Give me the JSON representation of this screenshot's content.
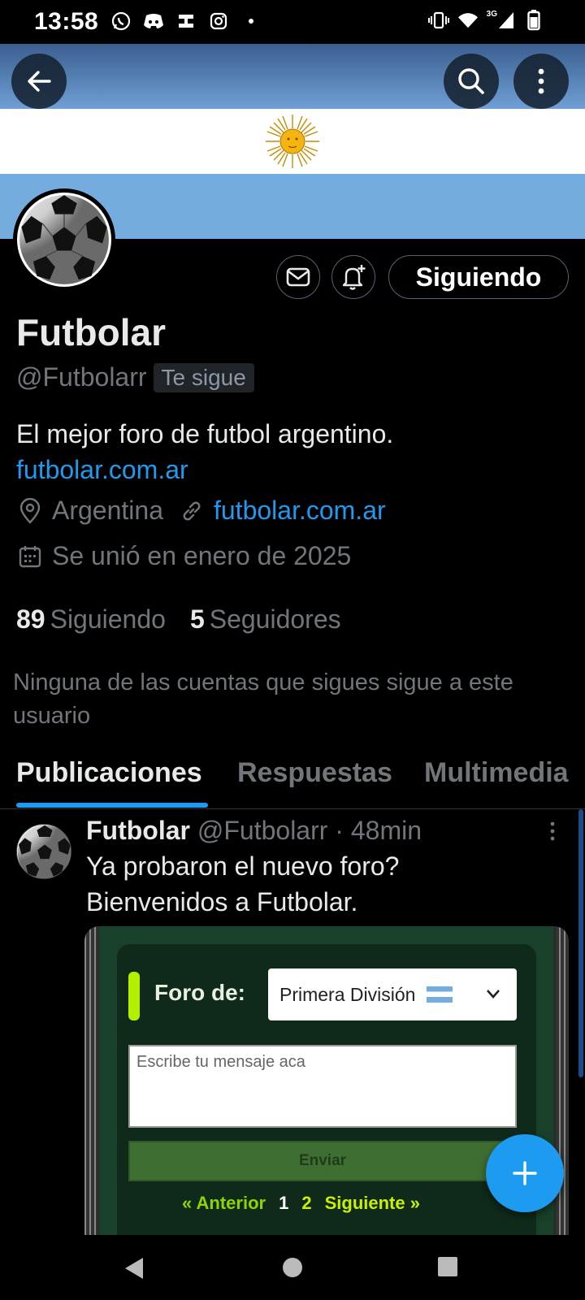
{
  "status_bar": {
    "time": "13:58",
    "left_icons": [
      "whatsapp-icon",
      "discord-icon",
      "app-icon",
      "instagram-icon",
      "dot-icon"
    ],
    "network_label": "3G",
    "right_icons": [
      "vibrate-icon",
      "wifi-icon",
      "signal-icon",
      "battery-icon"
    ]
  },
  "header": {
    "back_icon": "arrow-left-icon",
    "search_icon": "search-icon",
    "more_icon": "more-vertical-icon",
    "banner_colors": {
      "top": "#74acdf",
      "middle": "#ffffff",
      "bottom": "#74acdf",
      "sun": "#f6b40e"
    }
  },
  "profile": {
    "name": "Futbolar",
    "handle": "@Futbolarr",
    "follows_you": "Te sigue",
    "follow_button": "Siguiendo",
    "bio_line": "El mejor foro de futbol argentino.",
    "bio_link": "futbolar.com.ar",
    "location": "Argentina",
    "website": "futbolar.com.ar",
    "joined": "Se unió en enero de 2025",
    "following_count": "89",
    "following_label": "Siguiendo",
    "followers_count": "5",
    "followers_label": "Seguidores",
    "mutuals_note": "Ninguna de las cuentas que sigues sigue a este usuario"
  },
  "tabs": [
    {
      "label": "Publicaciones",
      "active": true
    },
    {
      "label": "Respuestas",
      "active": false
    },
    {
      "label": "Multimedia",
      "active": false
    }
  ],
  "post": {
    "author": "Futbolar",
    "handle": "@Futbolarr",
    "time": "· 48min",
    "text_line1": "Ya probaron el nuevo foro?",
    "text_line2": "Bienvenidos a Futbolar.",
    "media": {
      "foro_label": "Foro de:",
      "selected_forum": "Primera División",
      "message_placeholder": "Escribe tu mensaje aca",
      "send_button": "Enviar",
      "prev": "« Anterior",
      "page1": "1",
      "page2": "2",
      "next": "Siguiente »"
    }
  },
  "colors": {
    "accent": "#1d9bf0",
    "muted": "#71767b",
    "text": "#e7e9ea"
  }
}
